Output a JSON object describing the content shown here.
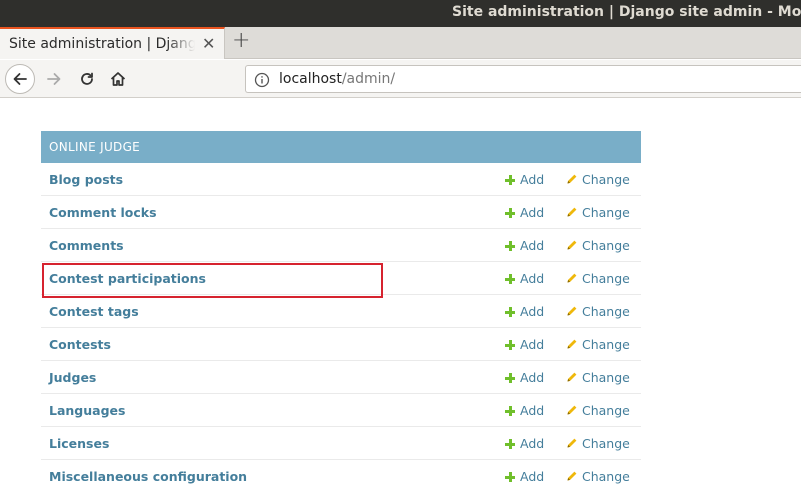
{
  "window": {
    "title": "Site administration | Django site admin - Mozilla Firefox"
  },
  "tab": {
    "title": "Site administration | Django site admin",
    "close_icon": "close-icon"
  },
  "newtab": {
    "label": "+"
  },
  "urlbar": {
    "host": "localhost",
    "path": "/admin/"
  },
  "module": {
    "caption": "ONLINE JUDGE",
    "add_label": "Add",
    "change_label": "Change",
    "rows": [
      "Blog posts",
      "Comment locks",
      "Comments",
      "Contest participations",
      "Contest tags",
      "Contests",
      "Judges",
      "Languages",
      "Licenses",
      "Miscellaneous configuration"
    ]
  },
  "colors": {
    "caption_bg": "#79aec8",
    "link": "#447e9b",
    "add_icon": "#70bf2b",
    "change_icon": "#efb80b",
    "highlight_box": "#d6232f"
  }
}
